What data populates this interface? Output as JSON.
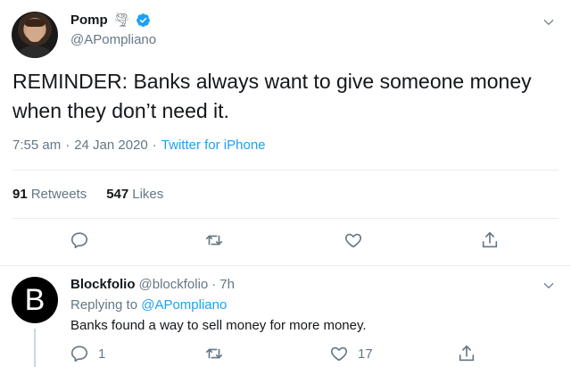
{
  "tweet": {
    "author": {
      "name": "Pomp",
      "badge_icon": "tornado-icon",
      "handle": "@APompliano",
      "verified": true
    },
    "text": "REMINDER: Banks always want to give someone money when they don’t need it.",
    "time": "7:55 am",
    "date": "24 Jan 2020",
    "separator": "·",
    "source": "Twitter for iPhone",
    "stats": {
      "retweets_count": "91",
      "retweets_label": "Retweets",
      "likes_count": "547",
      "likes_label": "Likes"
    }
  },
  "reply": {
    "avatar_letter": "B",
    "name": "Blockfolio",
    "handle": "@blockfolio",
    "separator": "·",
    "time": "7h",
    "replying_prefix": "Replying to",
    "replying_to": "@APompliano",
    "text": "Banks found a way to sell money for more money.",
    "actions": {
      "reply_count": "1",
      "like_count": "17"
    }
  },
  "colors": {
    "accent": "#1da1f2",
    "secondary_text": "#657786",
    "divider": "#e6ecf0"
  }
}
